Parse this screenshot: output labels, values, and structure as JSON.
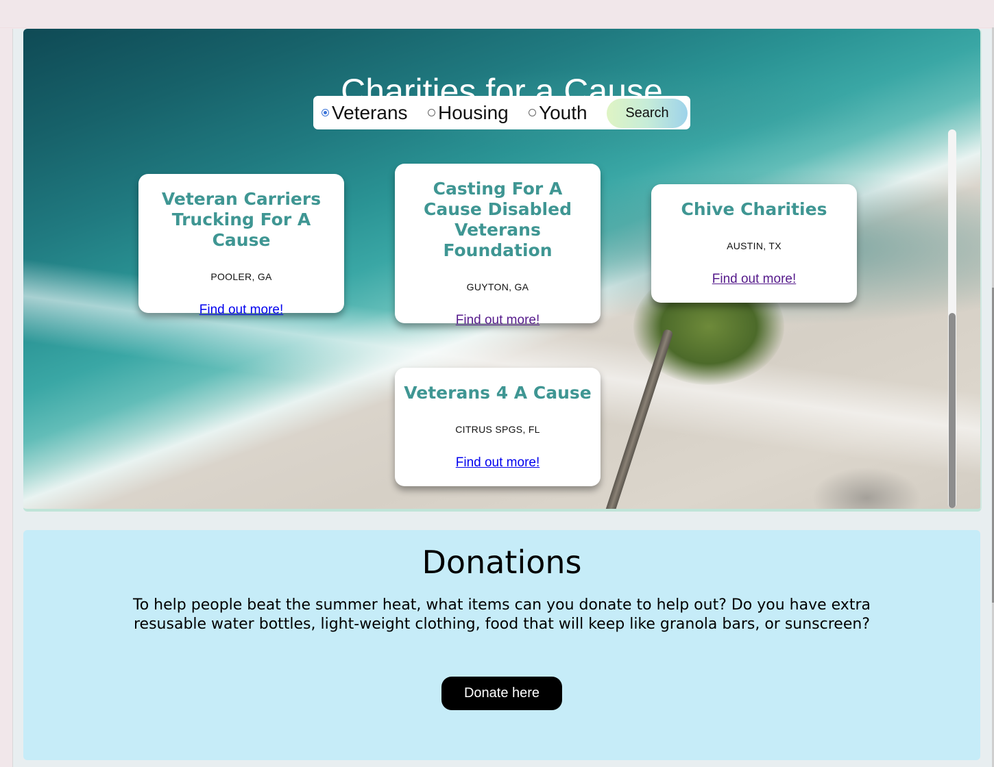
{
  "hero": {
    "title": "Charities for a Cause",
    "categories": [
      {
        "label": "Veterans",
        "checked": true
      },
      {
        "label": "Housing",
        "checked": false
      },
      {
        "label": "Youth",
        "checked": false
      }
    ],
    "search_label": "Search"
  },
  "charities": [
    {
      "name": "Veteran Carriers Trucking For A Cause",
      "location": "POOLER, GA",
      "link": "Find out more!"
    },
    {
      "name": "Casting For A Cause Disabled Veterans Foundation",
      "location": "GUYTON, GA",
      "link": "Find out more!"
    },
    {
      "name": "Chive Charities",
      "location": "AUSTIN, TX",
      "link": "Find out more!"
    },
    {
      "name": "Veterans 4 A Cause",
      "location": "CITRUS SPGS, FL",
      "link": "Find out more!"
    }
  ],
  "donations": {
    "title": "Donations",
    "text": "To help people beat the summer heat, what items can you donate to help out? Do you have extra resusable water bottles, light-weight clothing, food that will keep like granola bars, or sunscreen?",
    "button": "Donate here"
  },
  "colors": {
    "card_title": "#3f9693",
    "donations_bg": "#c6ecf8",
    "donate_button": "#000000"
  }
}
